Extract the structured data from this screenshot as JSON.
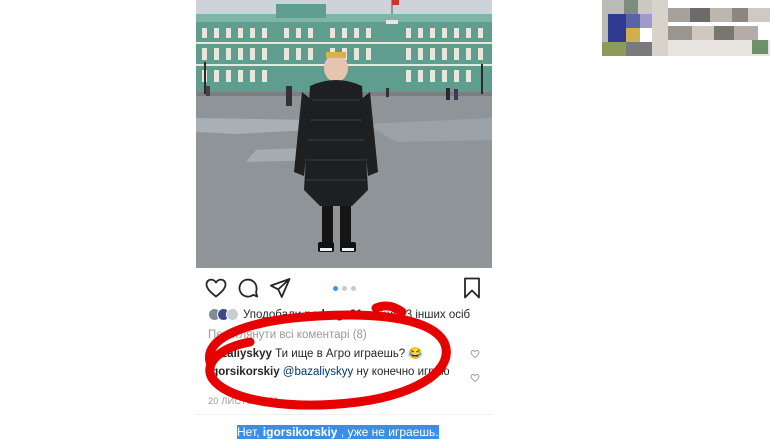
{
  "post": {
    "likes": {
      "prefix": "Уподобали",
      "user": "pedrogc31",
      "suffix": "та ще 13 інших осіб"
    },
    "view_all": "Переглянути всі коментарі (8)",
    "comments": [
      {
        "user": "bazaliyskyy",
        "text": "Ти ище в Агро играешь? 😂"
      },
      {
        "user": "igorsikorskiy",
        "mention": "@bazaliyskyy",
        "text": "ну конечно играю"
      }
    ],
    "date": "20 ЛИСТОПАДА",
    "carousel": {
      "count": 3,
      "active": 1
    }
  },
  "caption": {
    "before": "Нет, ",
    "user": "igorsikorskiy",
    "after": " , уже не играешь."
  },
  "colors": {
    "annotation": "#e60000",
    "link": "#003569",
    "highlight": "#3a8ee6",
    "carousel_active": "#3897f0"
  },
  "icons": [
    "heart-icon",
    "comment-icon",
    "share-icon",
    "bookmark-icon",
    "small-heart-icon"
  ]
}
